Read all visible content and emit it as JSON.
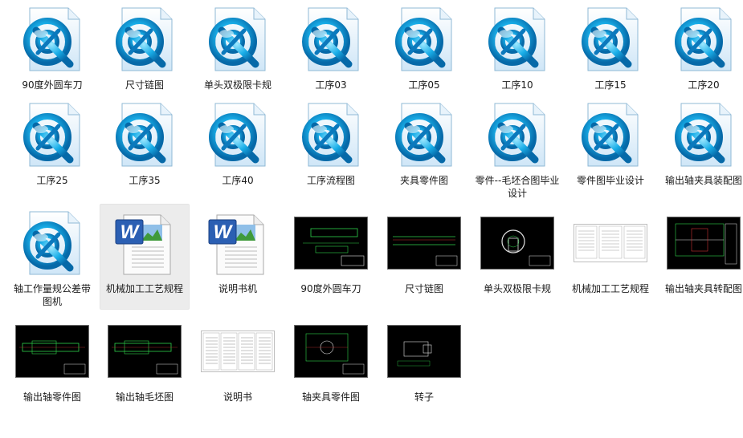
{
  "files": [
    {
      "name": "90度外圆车刀",
      "type": "cad"
    },
    {
      "name": "尺寸链图",
      "type": "cad"
    },
    {
      "name": "单头双极限卡规",
      "type": "cad"
    },
    {
      "name": "工序03",
      "type": "cad"
    },
    {
      "name": "工序05",
      "type": "cad"
    },
    {
      "name": "工序10",
      "type": "cad"
    },
    {
      "name": "工序15",
      "type": "cad"
    },
    {
      "name": "工序20",
      "type": "cad"
    },
    {
      "name": "工序25",
      "type": "cad"
    },
    {
      "name": "工序35",
      "type": "cad"
    },
    {
      "name": "工序40",
      "type": "cad"
    },
    {
      "name": "工序流程图",
      "type": "cad"
    },
    {
      "name": "夹具零件图",
      "type": "cad"
    },
    {
      "name": "零件--毛坯合图毕业设计",
      "type": "cad"
    },
    {
      "name": "零件图毕业设计",
      "type": "cad"
    },
    {
      "name": "输出轴夹具装配图",
      "type": "cad"
    },
    {
      "name": "轴工作量规公差带图机",
      "type": "cad"
    },
    {
      "name": "机械加工工艺规程",
      "type": "word",
      "selected": true
    },
    {
      "name": "说明书机",
      "type": "word"
    },
    {
      "name": "90度外圆车刀",
      "type": "thumb-dark",
      "variant": "tool"
    },
    {
      "name": "尺寸链图",
      "type": "thumb-dark",
      "variant": "chain"
    },
    {
      "name": "单头双极限卡规",
      "type": "thumb-dark",
      "variant": "gauge"
    },
    {
      "name": "机械加工工艺规程",
      "type": "thumb-light",
      "variant": "doc"
    },
    {
      "name": "输出轴夹具转配图",
      "type": "thumb-dark",
      "variant": "assembly"
    },
    {
      "name": "输出轴零件图",
      "type": "thumb-dark",
      "variant": "shaft"
    },
    {
      "name": "输出轴毛坯图",
      "type": "thumb-dark",
      "variant": "blank"
    },
    {
      "name": "说明书",
      "type": "thumb-light",
      "variant": "manual"
    },
    {
      "name": "轴夹具零件图",
      "type": "thumb-dark",
      "variant": "fixture"
    },
    {
      "name": "转子",
      "type": "thumb-dark",
      "variant": "rotor"
    }
  ],
  "colors": {
    "cad_blue": "#1aa3e6",
    "word_blue": "#2b5fb3",
    "cad_green": "#2fd24a",
    "selection": "#ececec"
  }
}
